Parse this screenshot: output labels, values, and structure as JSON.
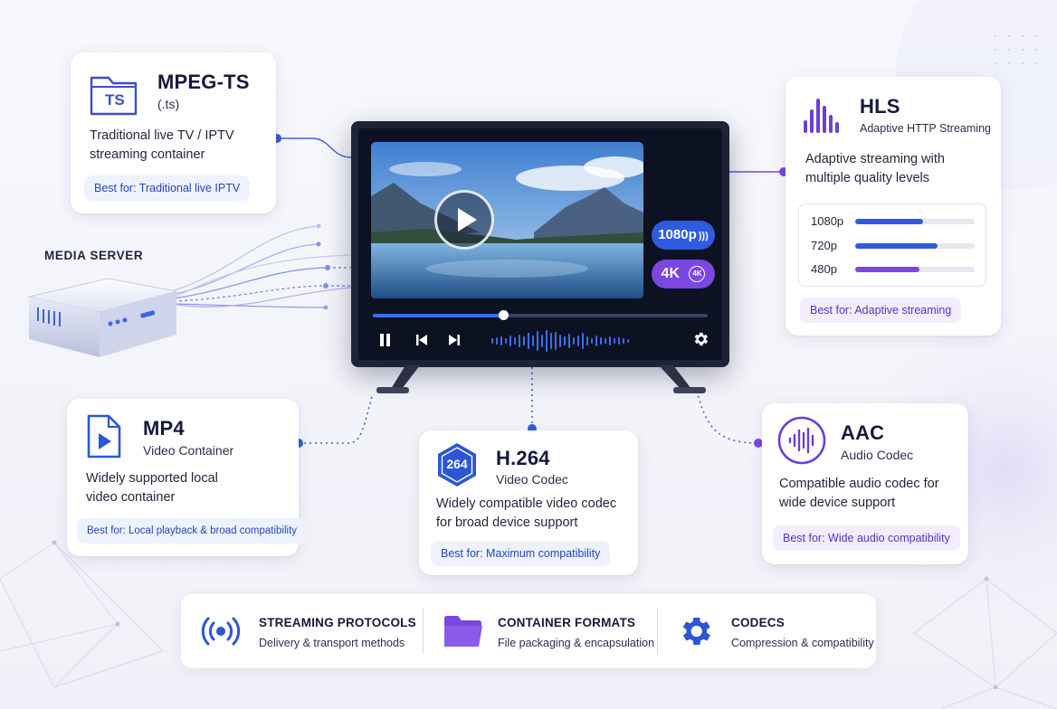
{
  "server": {
    "label": "MEDIA SERVER"
  },
  "mpegts": {
    "title": "MPEG-TS",
    "ext": "(.ts)",
    "icon_text": "TS",
    "description": "Traditional live TV / IPTV streaming container",
    "best_for": "Best for: Traditional live IPTV"
  },
  "hls": {
    "title": "HLS",
    "subtitle": "Adaptive HTTP Streaming",
    "description": "Adaptive streaming with multiple quality levels",
    "qualities": [
      {
        "label": "1080p",
        "level": 0.57,
        "color": "#2f5be0"
      },
      {
        "label": "720p",
        "level": 0.69,
        "color": "#2f5be0"
      },
      {
        "label": "480p",
        "level": 0.54,
        "color": "#7a47e0"
      }
    ],
    "best_for": "Best for: Adaptive streaming"
  },
  "mp4": {
    "title": "MP4",
    "subtitle": "Video Container",
    "description": "Widely supported local video container",
    "best_for": "Best for: Local playback & broad compatibility"
  },
  "h264": {
    "title": "H.264",
    "subtitle": "Video Codec",
    "icon_text": "264",
    "description": "Widely compatible video codec for broad device support",
    "best_for": "Best for: Maximum compatibility"
  },
  "aac": {
    "title": "AAC",
    "subtitle": "Audio Codec",
    "description": "Compatible audio codec for wide device support",
    "best_for": "Best for: Wide audio compatibility"
  },
  "player": {
    "badge_resolution": "1080p",
    "badge_4k": "4K",
    "badge_4k_circle": "4K",
    "progress": 0.39
  },
  "legend": [
    {
      "title": "STREAMING PROTOCOLS",
      "subtitle": "Delivery & transport methods",
      "icon": "broadcast-icon"
    },
    {
      "title": "CONTAINER FORMATS",
      "subtitle": "File packaging & encapsulation",
      "icon": "folder-icon"
    },
    {
      "title": "CODECS",
      "subtitle": "Compression & compatibility",
      "icon": "gear-icon"
    }
  ],
  "colors": {
    "blue": "#2f5be0",
    "purple": "#7a47e0",
    "navy": "#16193a"
  }
}
